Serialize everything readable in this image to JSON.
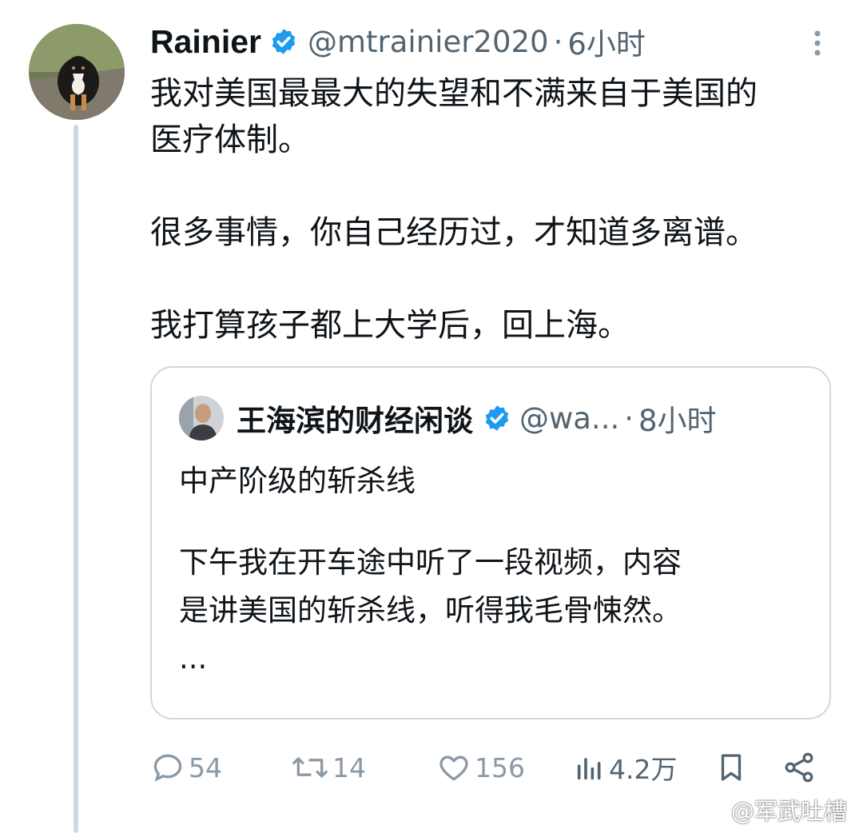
{
  "tweet": {
    "author_name": "Rainier",
    "handle": "@mtrainier2020",
    "separator": "·",
    "time": "6小时",
    "text_lines": [
      "我对美国最最大的失望和不满来自于美国的",
      "医疗体制。",
      "很多事情，你自己经历过，才知道多离谱。",
      "我打算孩子都上大学后，回上海。"
    ]
  },
  "quote": {
    "author_name": "王海滨的财经闲谈",
    "handle": "@wa...",
    "separator": "·",
    "time": "8小时",
    "text_lines": [
      "中产阶级的斩杀线",
      "下午我在开车途中听了一段视频，内容",
      "是讲美国的斩杀线，听得我毛骨悚然。",
      "..."
    ]
  },
  "actions": {
    "replies": "54",
    "retweets": "14",
    "likes": "156",
    "views": "4.2万"
  },
  "icons": [
    "verified-icon",
    "more-icon",
    "reply-icon",
    "retweet-icon",
    "like-icon",
    "views-icon",
    "bookmark-icon",
    "share-icon",
    "weibo-icon"
  ],
  "colors": {
    "verified": "#1d9bf0",
    "muted": "#536471",
    "border": "#cfd9de"
  },
  "watermark": "@军武吐槽"
}
